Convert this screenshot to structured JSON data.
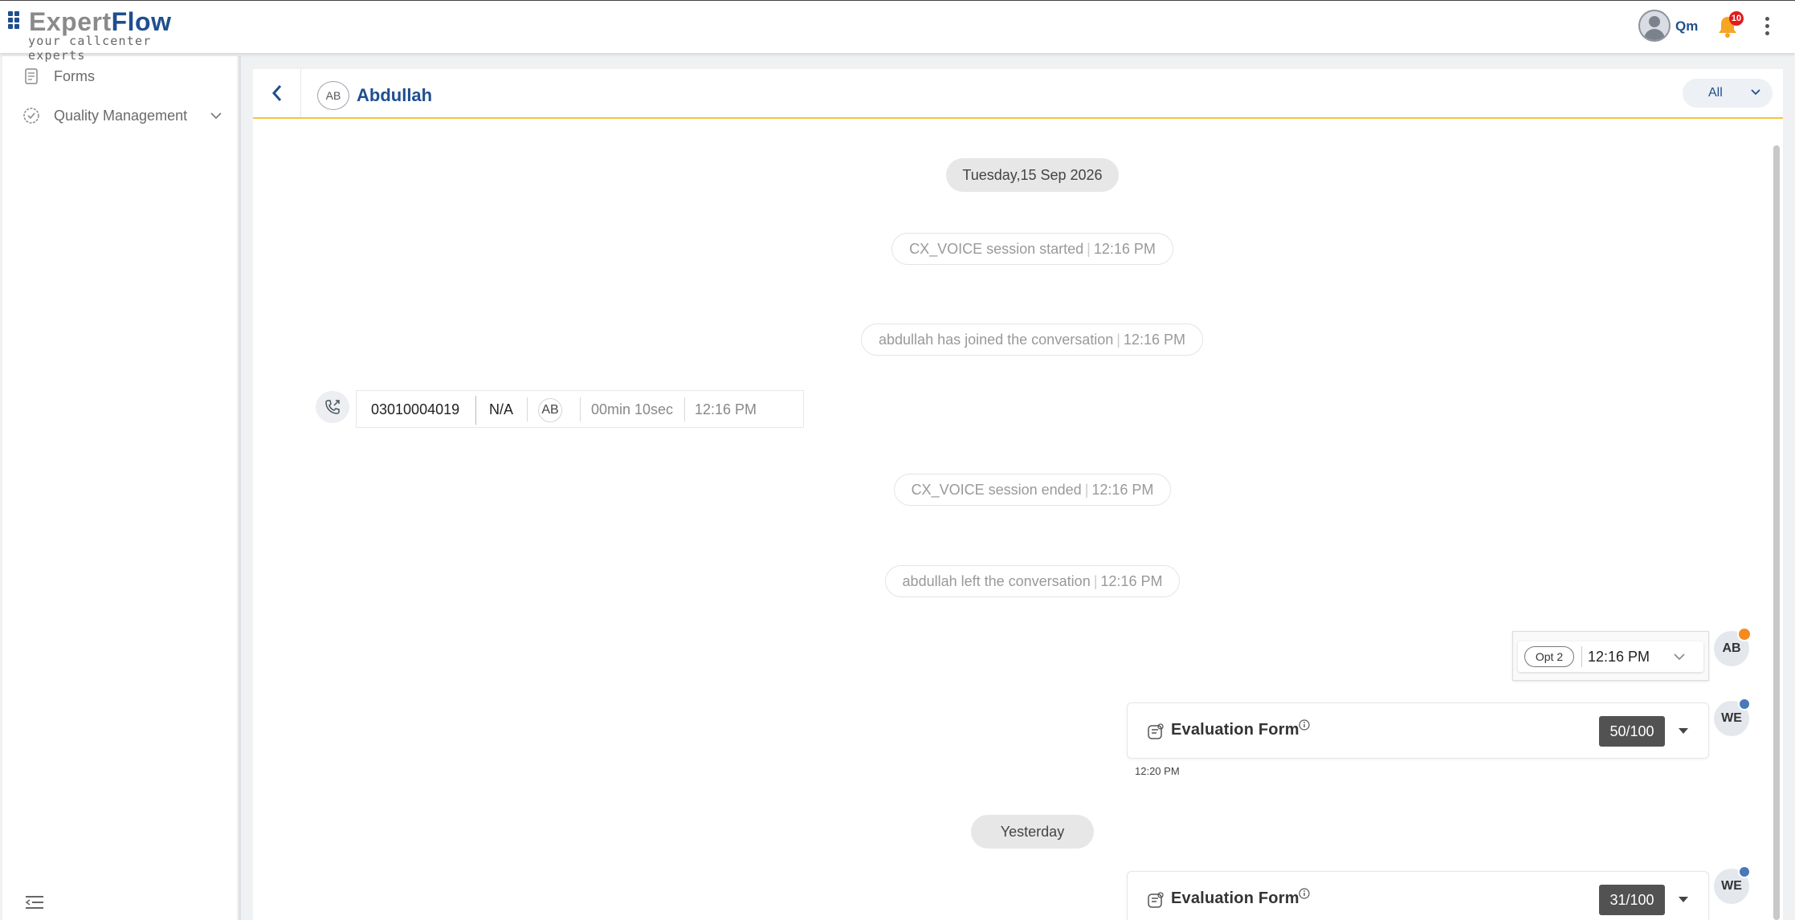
{
  "header": {
    "logo_expert": "Expert",
    "logo_flow": "Flow",
    "logo_tagline": "your callcenter experts",
    "user_name": "Qm",
    "notification_count": "10"
  },
  "sidebar": {
    "items": [
      {
        "label": "Forms",
        "icon": "form-icon"
      },
      {
        "label": "Quality Management",
        "icon": "check-badge-icon"
      }
    ]
  },
  "conversation": {
    "customer_initials": "AB",
    "customer_name": "Abdullah",
    "filter_value": "All"
  },
  "timeline": {
    "date_1": "Tuesday,15 Sep 2026",
    "date_2": "Yesterday",
    "events": [
      {
        "text": "CX_VOICE session started",
        "time": "12:16 PM"
      },
      {
        "text": "abdullah has joined the conversation",
        "time": "12:16 PM"
      },
      {
        "text": "CX_VOICE session ended",
        "time": "12:16 PM"
      },
      {
        "text": "abdullah left the conversation",
        "time": "12:16 PM"
      }
    ],
    "call": {
      "number": "03010004019",
      "na": "N/A",
      "agent_initials": "AB",
      "duration": "00min 10sec",
      "time": "12:16 PM"
    },
    "option_message": {
      "tag": "Opt 2",
      "time": "12:16 PM",
      "avatar": "AB"
    },
    "evaluations": [
      {
        "title": "Evaluation Form",
        "score": "50/100",
        "time": "12:20 PM",
        "avatar": "WE"
      },
      {
        "title": "Evaluation Form",
        "score": "31/100",
        "avatar": "WE"
      }
    ]
  },
  "colors": {
    "brand_blue": "#1e4f8f",
    "accent_yellow": "#f5c441",
    "badge_red": "#e21b1b",
    "score_bg": "#525252"
  }
}
